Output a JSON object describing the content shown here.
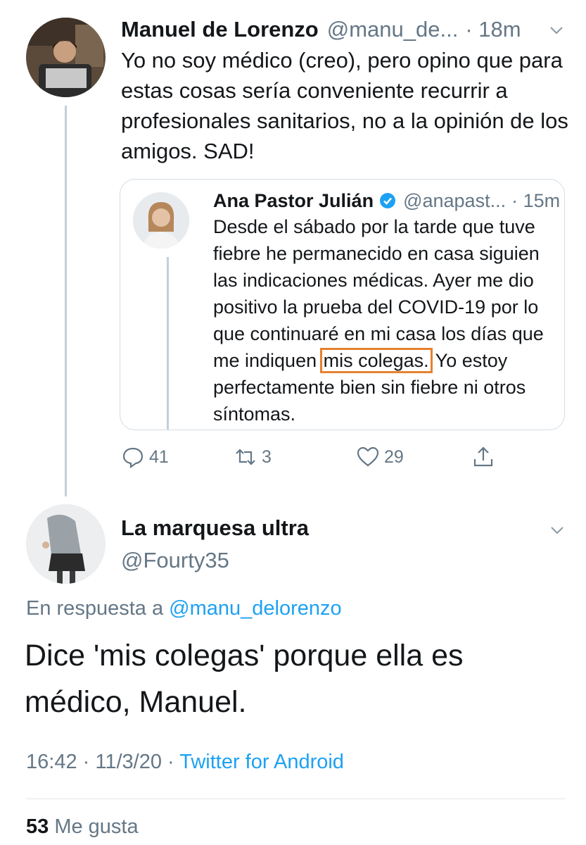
{
  "tweet": {
    "author_name": "Manuel de Lorenzo",
    "author_handle": "@manu_de...",
    "time": "· 18m",
    "text": "Yo no soy médico (creo), pero opino que para estas cosas sería conveniente recurrir a profesionales sanitarios, no a la opinión de los amigos. SAD!",
    "quoted": {
      "author_name": "Ana Pastor Julián",
      "author_handle": "@anapast...",
      "time": "· 15m",
      "text_before": "Desde el sábado por la tarde que tuve\nfiebre he permanecido en casa siguien\nlas indicaciones médicas. Ayer me dio\npositivo la prueba del COVID-19 por lo\nque continuaré en mi casa los días que\nme indiquen ",
      "highlighted": "mis colegas.",
      "text_after": " Yo estoy\nperfectamente bien sin fiebre ni otros\nsíntomas."
    },
    "actions": {
      "replies": "41",
      "retweets": "3",
      "likes": "29"
    }
  },
  "reply": {
    "author_name": "La marquesa ultra",
    "author_handle": "@Fourty35",
    "reply_prefix": "En respuesta a",
    "reply_mention": "@manu_delorenzo",
    "text": "Dice 'mis colegas' porque ella es médico, Manuel.",
    "timestamp": "16:42 · 11/3/20 ·",
    "source": "Twitter for Android",
    "like_count": "53",
    "like_label": "Me gusta"
  },
  "colors": {
    "link": "#1da1f2",
    "secondary": "#657786",
    "highlight": "#e5812f",
    "verified": "#1da1f2"
  }
}
